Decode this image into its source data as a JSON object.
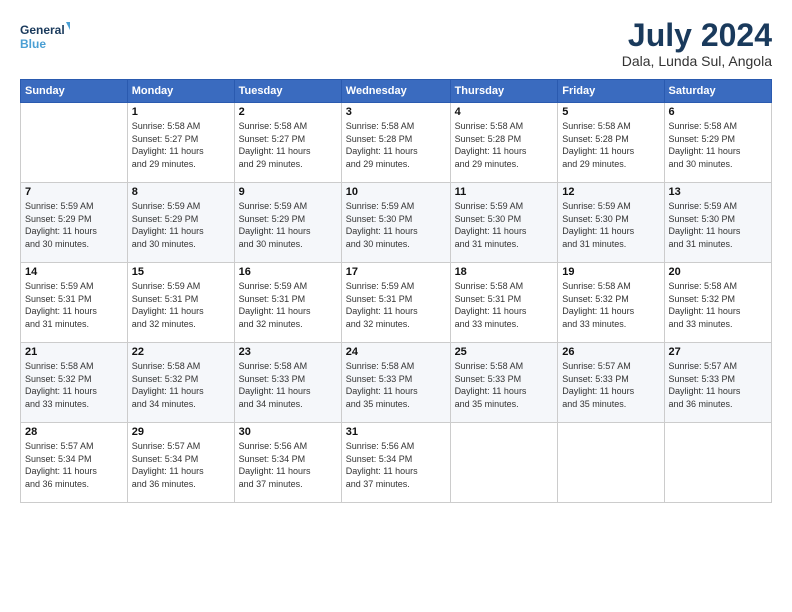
{
  "header": {
    "logo_line1": "General",
    "logo_line2": "Blue",
    "month": "July 2024",
    "location": "Dala, Lunda Sul, Angola"
  },
  "weekdays": [
    "Sunday",
    "Monday",
    "Tuesday",
    "Wednesday",
    "Thursday",
    "Friday",
    "Saturday"
  ],
  "weeks": [
    [
      {
        "day": "",
        "info": ""
      },
      {
        "day": "1",
        "info": "Sunrise: 5:58 AM\nSunset: 5:27 PM\nDaylight: 11 hours\nand 29 minutes."
      },
      {
        "day": "2",
        "info": "Sunrise: 5:58 AM\nSunset: 5:27 PM\nDaylight: 11 hours\nand 29 minutes."
      },
      {
        "day": "3",
        "info": "Sunrise: 5:58 AM\nSunset: 5:28 PM\nDaylight: 11 hours\nand 29 minutes."
      },
      {
        "day": "4",
        "info": "Sunrise: 5:58 AM\nSunset: 5:28 PM\nDaylight: 11 hours\nand 29 minutes."
      },
      {
        "day": "5",
        "info": "Sunrise: 5:58 AM\nSunset: 5:28 PM\nDaylight: 11 hours\nand 29 minutes."
      },
      {
        "day": "6",
        "info": "Sunrise: 5:58 AM\nSunset: 5:29 PM\nDaylight: 11 hours\nand 30 minutes."
      }
    ],
    [
      {
        "day": "7",
        "info": "Sunrise: 5:59 AM\nSunset: 5:29 PM\nDaylight: 11 hours\nand 30 minutes."
      },
      {
        "day": "8",
        "info": "Sunrise: 5:59 AM\nSunset: 5:29 PM\nDaylight: 11 hours\nand 30 minutes."
      },
      {
        "day": "9",
        "info": "Sunrise: 5:59 AM\nSunset: 5:29 PM\nDaylight: 11 hours\nand 30 minutes."
      },
      {
        "day": "10",
        "info": "Sunrise: 5:59 AM\nSunset: 5:30 PM\nDaylight: 11 hours\nand 30 minutes."
      },
      {
        "day": "11",
        "info": "Sunrise: 5:59 AM\nSunset: 5:30 PM\nDaylight: 11 hours\nand 31 minutes."
      },
      {
        "day": "12",
        "info": "Sunrise: 5:59 AM\nSunset: 5:30 PM\nDaylight: 11 hours\nand 31 minutes."
      },
      {
        "day": "13",
        "info": "Sunrise: 5:59 AM\nSunset: 5:30 PM\nDaylight: 11 hours\nand 31 minutes."
      }
    ],
    [
      {
        "day": "14",
        "info": "Sunrise: 5:59 AM\nSunset: 5:31 PM\nDaylight: 11 hours\nand 31 minutes."
      },
      {
        "day": "15",
        "info": "Sunrise: 5:59 AM\nSunset: 5:31 PM\nDaylight: 11 hours\nand 32 minutes."
      },
      {
        "day": "16",
        "info": "Sunrise: 5:59 AM\nSunset: 5:31 PM\nDaylight: 11 hours\nand 32 minutes."
      },
      {
        "day": "17",
        "info": "Sunrise: 5:59 AM\nSunset: 5:31 PM\nDaylight: 11 hours\nand 32 minutes."
      },
      {
        "day": "18",
        "info": "Sunrise: 5:58 AM\nSunset: 5:31 PM\nDaylight: 11 hours\nand 33 minutes."
      },
      {
        "day": "19",
        "info": "Sunrise: 5:58 AM\nSunset: 5:32 PM\nDaylight: 11 hours\nand 33 minutes."
      },
      {
        "day": "20",
        "info": "Sunrise: 5:58 AM\nSunset: 5:32 PM\nDaylight: 11 hours\nand 33 minutes."
      }
    ],
    [
      {
        "day": "21",
        "info": "Sunrise: 5:58 AM\nSunset: 5:32 PM\nDaylight: 11 hours\nand 33 minutes."
      },
      {
        "day": "22",
        "info": "Sunrise: 5:58 AM\nSunset: 5:32 PM\nDaylight: 11 hours\nand 34 minutes."
      },
      {
        "day": "23",
        "info": "Sunrise: 5:58 AM\nSunset: 5:33 PM\nDaylight: 11 hours\nand 34 minutes."
      },
      {
        "day": "24",
        "info": "Sunrise: 5:58 AM\nSunset: 5:33 PM\nDaylight: 11 hours\nand 35 minutes."
      },
      {
        "day": "25",
        "info": "Sunrise: 5:58 AM\nSunset: 5:33 PM\nDaylight: 11 hours\nand 35 minutes."
      },
      {
        "day": "26",
        "info": "Sunrise: 5:57 AM\nSunset: 5:33 PM\nDaylight: 11 hours\nand 35 minutes."
      },
      {
        "day": "27",
        "info": "Sunrise: 5:57 AM\nSunset: 5:33 PM\nDaylight: 11 hours\nand 36 minutes."
      }
    ],
    [
      {
        "day": "28",
        "info": "Sunrise: 5:57 AM\nSunset: 5:34 PM\nDaylight: 11 hours\nand 36 minutes."
      },
      {
        "day": "29",
        "info": "Sunrise: 5:57 AM\nSunset: 5:34 PM\nDaylight: 11 hours\nand 36 minutes."
      },
      {
        "day": "30",
        "info": "Sunrise: 5:56 AM\nSunset: 5:34 PM\nDaylight: 11 hours\nand 37 minutes."
      },
      {
        "day": "31",
        "info": "Sunrise: 5:56 AM\nSunset: 5:34 PM\nDaylight: 11 hours\nand 37 minutes."
      },
      {
        "day": "",
        "info": ""
      },
      {
        "day": "",
        "info": ""
      },
      {
        "day": "",
        "info": ""
      }
    ]
  ]
}
